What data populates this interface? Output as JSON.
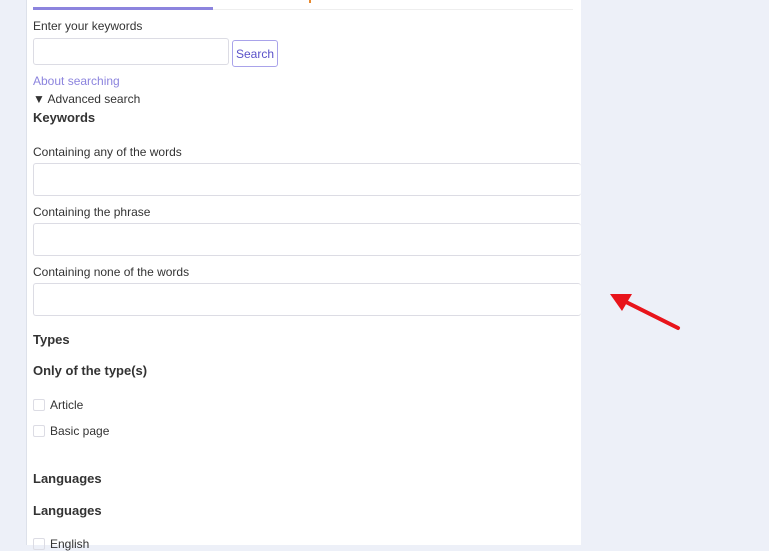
{
  "search": {
    "label": "Enter your keywords",
    "value": "",
    "button": "Search",
    "about_link": "About searching",
    "advanced_toggle": "▼ Advanced search"
  },
  "keywords": {
    "heading": "Keywords",
    "any_label": "Containing any of the words",
    "phrase_label": "Containing the phrase",
    "none_label": "Containing none of the words"
  },
  "types": {
    "heading": "Types",
    "subheading": "Only of the type(s)",
    "options": [
      "Article",
      "Basic page"
    ]
  },
  "languages": {
    "heading": "Languages",
    "subheading": "Languages",
    "options": [
      "English"
    ]
  },
  "colors": {
    "accent": "#8c84de",
    "arrow": "#e8141b"
  }
}
